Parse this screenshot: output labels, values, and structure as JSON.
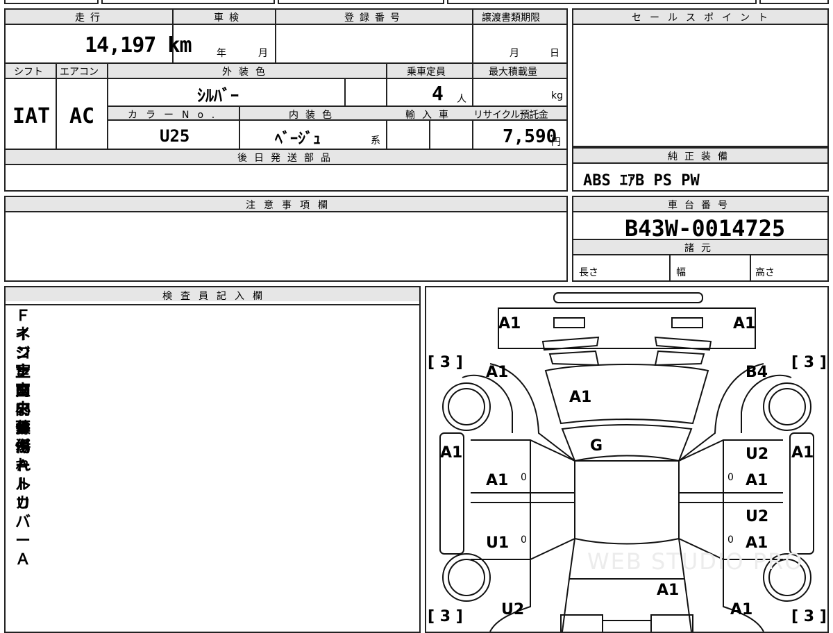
{
  "labels": {
    "mileage": "走行",
    "shaken": "車検",
    "reg_no": "登録番号",
    "transfer_deadline": "譲渡書類期限",
    "sales_point": "セールスポイント",
    "shift": "シフト",
    "aircon": "エアコン",
    "ext_color": "外装色",
    "capacity": "乗車定員",
    "max_load": "最大積載量",
    "color_no": "カラーNo.",
    "int_color": "内装色",
    "import": "輸入車",
    "recycle": "リサイクル預託金",
    "later_parts": "後日発送部品",
    "std_equipment": "純正装備",
    "notes": "注意事項欄",
    "chassis_no": "車台番号",
    "specs": "諸元",
    "length": "長さ",
    "width": "幅",
    "height": "高さ",
    "inspector": "検査員記入欄"
  },
  "values": {
    "mileage": "14,197 km",
    "year_unit": "年",
    "month_unit": "月",
    "deadline_month": "月",
    "deadline_day": "日",
    "shift": "IAT",
    "aircon": "AC",
    "ext_color": "ｼﾙﾊﾞｰ",
    "capacity": "4",
    "capacity_unit": "人",
    "max_load_unit": "kg",
    "color_no": "U25",
    "int_color": "ﾍﾞｰｼﾞｭ",
    "int_color_suffix": "系",
    "recycle": "7,590",
    "recycle_unit": "円",
    "std_equipment": "ABS ｴｱB PS PW",
    "chassis_no": "B43W-0014725"
  },
  "inspector_notes": [
    "Ｆインナー小Ｕ",
    "ネジ止ロアサポートＵ",
    "コンソール傷",
    "室内内張傷",
    "室内薄汚れ",
    "ミラーＡ",
    "ホイールカバーＡ"
  ],
  "diagram": {
    "front_left": "A1",
    "front_right": "A1",
    "fender_left": "A1",
    "fender_right": "B4",
    "hood": "A1",
    "windshield": "G",
    "pillar_left": "A1",
    "pillar_right": "A1",
    "door_fl": "A1",
    "door_fr_top": "U2",
    "door_fr": "A1",
    "door_rl": "U1",
    "door_rr_top": "U2",
    "door_rr": "A1",
    "rear_fender_left": "U2",
    "roof_rear": "A1",
    "rear_right": "A1",
    "tire_fl": "3",
    "tire_fr": "3",
    "tire_rl": "3",
    "tire_rr": "3",
    "zero_fl": "0",
    "zero_fr": "0",
    "zero_rl": "0",
    "zero_rr": "0",
    "watermark": "WEB STUDIO PRO"
  }
}
